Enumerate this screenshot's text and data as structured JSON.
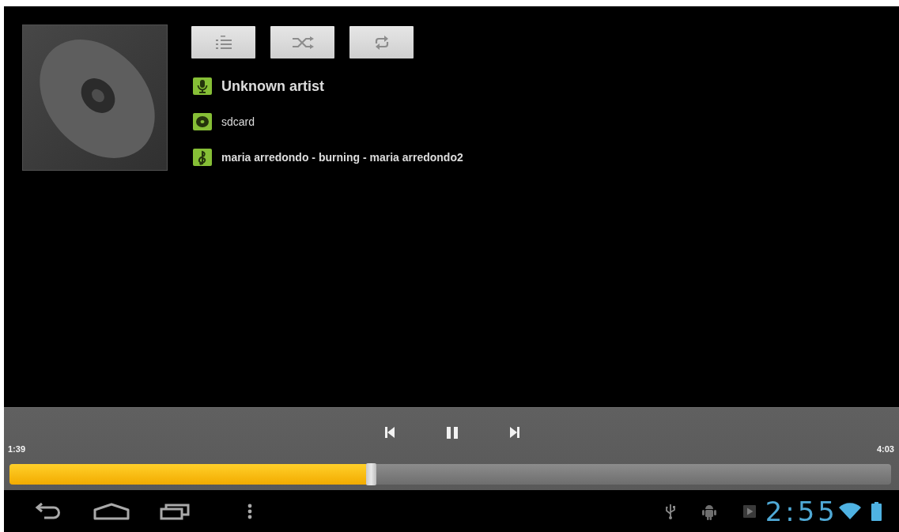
{
  "toolbar": [
    {
      "kind": "playlist"
    },
    {
      "kind": "shuffle"
    },
    {
      "kind": "repeat"
    }
  ],
  "track_info": [
    {
      "kind": "artist",
      "text": "Unknown artist"
    },
    {
      "kind": "album",
      "text": "sdcard"
    },
    {
      "kind": "title",
      "text": "maria arredondo - burning - maria arredondo2"
    }
  ],
  "playback": {
    "controls": [
      {
        "kind": "previous"
      },
      {
        "kind": "pause"
      },
      {
        "kind": "next"
      }
    ],
    "elapsed": "1:39",
    "duration": "4:03",
    "level": 0.41
  },
  "system_bar": {
    "nav_buttons": [
      {
        "kind": "back"
      },
      {
        "kind": "home"
      },
      {
        "kind": "recent"
      },
      {
        "kind": "menu"
      }
    ],
    "notifications": [
      {
        "kind": "usb"
      },
      {
        "kind": "android"
      },
      {
        "kind": "media"
      }
    ],
    "clock": "2:55"
  }
}
